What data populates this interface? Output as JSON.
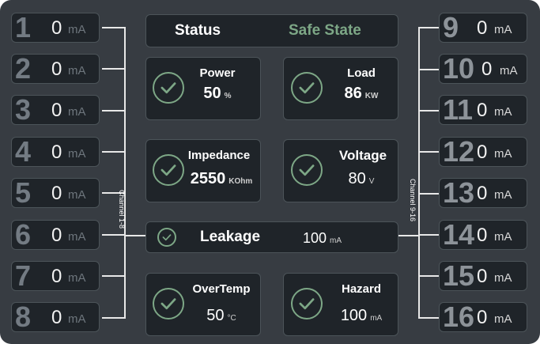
{
  "status": {
    "label": "Status",
    "state": "Safe State",
    "state_color": "#7da786"
  },
  "left_group_label": "Channel 1-8",
  "right_group_label": "Channel 9-16",
  "channels_left": [
    {
      "num": "1",
      "value": "0",
      "unit": "mA"
    },
    {
      "num": "2",
      "value": "0",
      "unit": "mA"
    },
    {
      "num": "3",
      "value": "0",
      "unit": "mA"
    },
    {
      "num": "4",
      "value": "0",
      "unit": "mA"
    },
    {
      "num": "5",
      "value": "0",
      "unit": "mA"
    },
    {
      "num": "6",
      "value": "0",
      "unit": "mA"
    },
    {
      "num": "7",
      "value": "0",
      "unit": "mA"
    },
    {
      "num": "8",
      "value": "0",
      "unit": "mA"
    }
  ],
  "channels_right": [
    {
      "num": "9",
      "value": "0",
      "unit": "mA"
    },
    {
      "num": "10",
      "value": "0",
      "unit": "mA"
    },
    {
      "num": "11",
      "value": "0",
      "unit": "mA"
    },
    {
      "num": "12",
      "value": "0",
      "unit": "mA"
    },
    {
      "num": "13",
      "value": "0",
      "unit": "mA"
    },
    {
      "num": "14",
      "value": "0",
      "unit": "mA"
    },
    {
      "num": "15",
      "value": "0",
      "unit": "mA"
    },
    {
      "num": "16",
      "value": "0",
      "unit": "mA"
    }
  ],
  "cards": {
    "power": {
      "title": "Power",
      "value": "50",
      "unit": "%"
    },
    "load": {
      "title": "Load",
      "value": "86",
      "unit": "KW"
    },
    "impedance": {
      "title": "Impedance",
      "value": "2550",
      "unit": "KOhm"
    },
    "voltage": {
      "title": "Voltage",
      "value": "80",
      "unit": "V"
    },
    "leakage": {
      "title": "Leakage",
      "value": "100",
      "unit": "mA"
    },
    "overtemp": {
      "title": "OverTemp",
      "value": "50",
      "unit": "°C"
    },
    "hazard": {
      "title": "Hazard",
      "value": "100",
      "unit": "mA"
    }
  },
  "icons": {
    "check": "check-circle-icon"
  }
}
